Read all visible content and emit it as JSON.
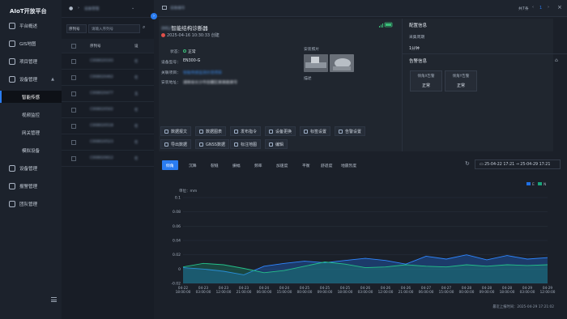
{
  "app": {
    "title": "AIoT开放平台"
  },
  "sidebar": {
    "items": [
      {
        "label": "平台概述"
      },
      {
        "label": "GIS地图"
      },
      {
        "label": "项目管理"
      },
      {
        "label": "设备管理"
      },
      {
        "label": "智能传感"
      },
      {
        "label": "视频监控"
      },
      {
        "label": "网关管理"
      },
      {
        "label": "模拟设备"
      },
      {
        "label": "设备管理"
      },
      {
        "label": "报警管理"
      },
      {
        "label": "团队管理"
      }
    ]
  },
  "list": {
    "filter_select": "序列号",
    "search_placeholder": "请输入序列号",
    "column_serial": "序列号",
    "column_status": "设",
    "rows": [
      {
        "serial": "C008020193",
        "status": "在"
      },
      {
        "serial": "C008020462",
        "status": "在"
      },
      {
        "serial": "C008020477",
        "status": "五"
      },
      {
        "serial": "C008020502",
        "status": "在"
      },
      {
        "serial": "C008020518",
        "status": "在"
      },
      {
        "serial": "C008020523",
        "status": "在"
      },
      {
        "serial": "C008020612",
        "status": "在"
      }
    ]
  },
  "topbar": {
    "breadcrumb": "设备管理",
    "device_tag": "设备编号",
    "total": "共7条",
    "page": "1"
  },
  "device": {
    "title_prefix": "IMU",
    "title": "智能结构诊断器",
    "created": "2025-04-16 10:30:33 创建",
    "status_label": "状态：",
    "status_value": "正常",
    "model_label": "设备型号：",
    "model_value": "EN300-G",
    "project_label": "关联项目：",
    "project_value": "智能传感监测示范项目",
    "address_label": "安装地址：",
    "address_value": "湖南省长沙市岳麓区某某路某号",
    "photos_label": "安装照片",
    "note_label": "描述"
  },
  "actions": [
    {
      "label": "数据报文"
    },
    {
      "label": "数据图表"
    },
    {
      "label": "发布指令"
    },
    {
      "label": "设备更换"
    },
    {
      "label": "标签设置"
    },
    {
      "label": "告警设置"
    },
    {
      "label": "导出数据"
    },
    {
      "label": "GNSS数据"
    },
    {
      "label": "标注地图"
    },
    {
      "label": "编辑"
    }
  ],
  "config": {
    "title": "配置信息",
    "period_label": "采集周期",
    "period_value": "1分钟"
  },
  "alarm": {
    "title": "告警信息",
    "boxes": [
      {
        "label": "倾角X告警",
        "status": "正常"
      },
      {
        "label": "倾角Y告警",
        "status": "正常"
      }
    ]
  },
  "chart_tabs": [
    "倾角",
    "沉降",
    "裂缝",
    "振幅",
    "频率",
    "加速度",
    "平衡",
    "舒适度",
    "地震烈度"
  ],
  "date_range": {
    "start": "25-04-22 17:21",
    "end": "25-04-29 17:21"
  },
  "colors": {
    "accent": "#2a7cf0",
    "series_e": "#1f6fe5",
    "series_n": "#1aa37a"
  },
  "chart_data": {
    "type": "area",
    "unit_label": "单位：mm",
    "ylim": [
      -0.02,
      0.1
    ],
    "yticks": [
      "0.1",
      "0.08",
      "0.06",
      "0.04",
      "0.02",
      "0",
      "-0.02"
    ],
    "x": [
      "04-22 18:00:00",
      "04-23 03:00:00",
      "04-23 12:00:00",
      "04-23 21:00:00",
      "04-24 06:00:00",
      "04-24 15:00:00",
      "04-25 00:00:00",
      "04-25 09:00:00",
      "04-25 18:00:00",
      "04-26 03:00:00",
      "04-26 12:00:00",
      "04-26 21:00:00",
      "04-27 06:00:00",
      "04-27 15:00:00",
      "04-28 00:00:00",
      "04-28 09:00:00",
      "04-28 18:00:00",
      "04-29 03:00:00",
      "04-29 12:00:00"
    ],
    "legend": [
      "E",
      "N"
    ],
    "series": [
      {
        "name": "E",
        "values": [
          0.002,
          0.0,
          -0.003,
          -0.008,
          0.004,
          0.008,
          0.011,
          0.009,
          0.012,
          0.015,
          0.012,
          0.007,
          0.018,
          0.014,
          0.02,
          0.013,
          0.019,
          0.014,
          0.016
        ]
      },
      {
        "name": "N",
        "values": [
          0.003,
          0.008,
          0.006,
          0.001,
          -0.005,
          -0.002,
          0.004,
          0.01,
          0.007,
          0.002,
          0.003,
          0.006,
          0.004,
          0.003,
          0.006,
          0.004,
          0.006,
          0.005,
          0.006
        ]
      }
    ],
    "footer": "最近上报时间：2025-04-29 17:21:02"
  }
}
